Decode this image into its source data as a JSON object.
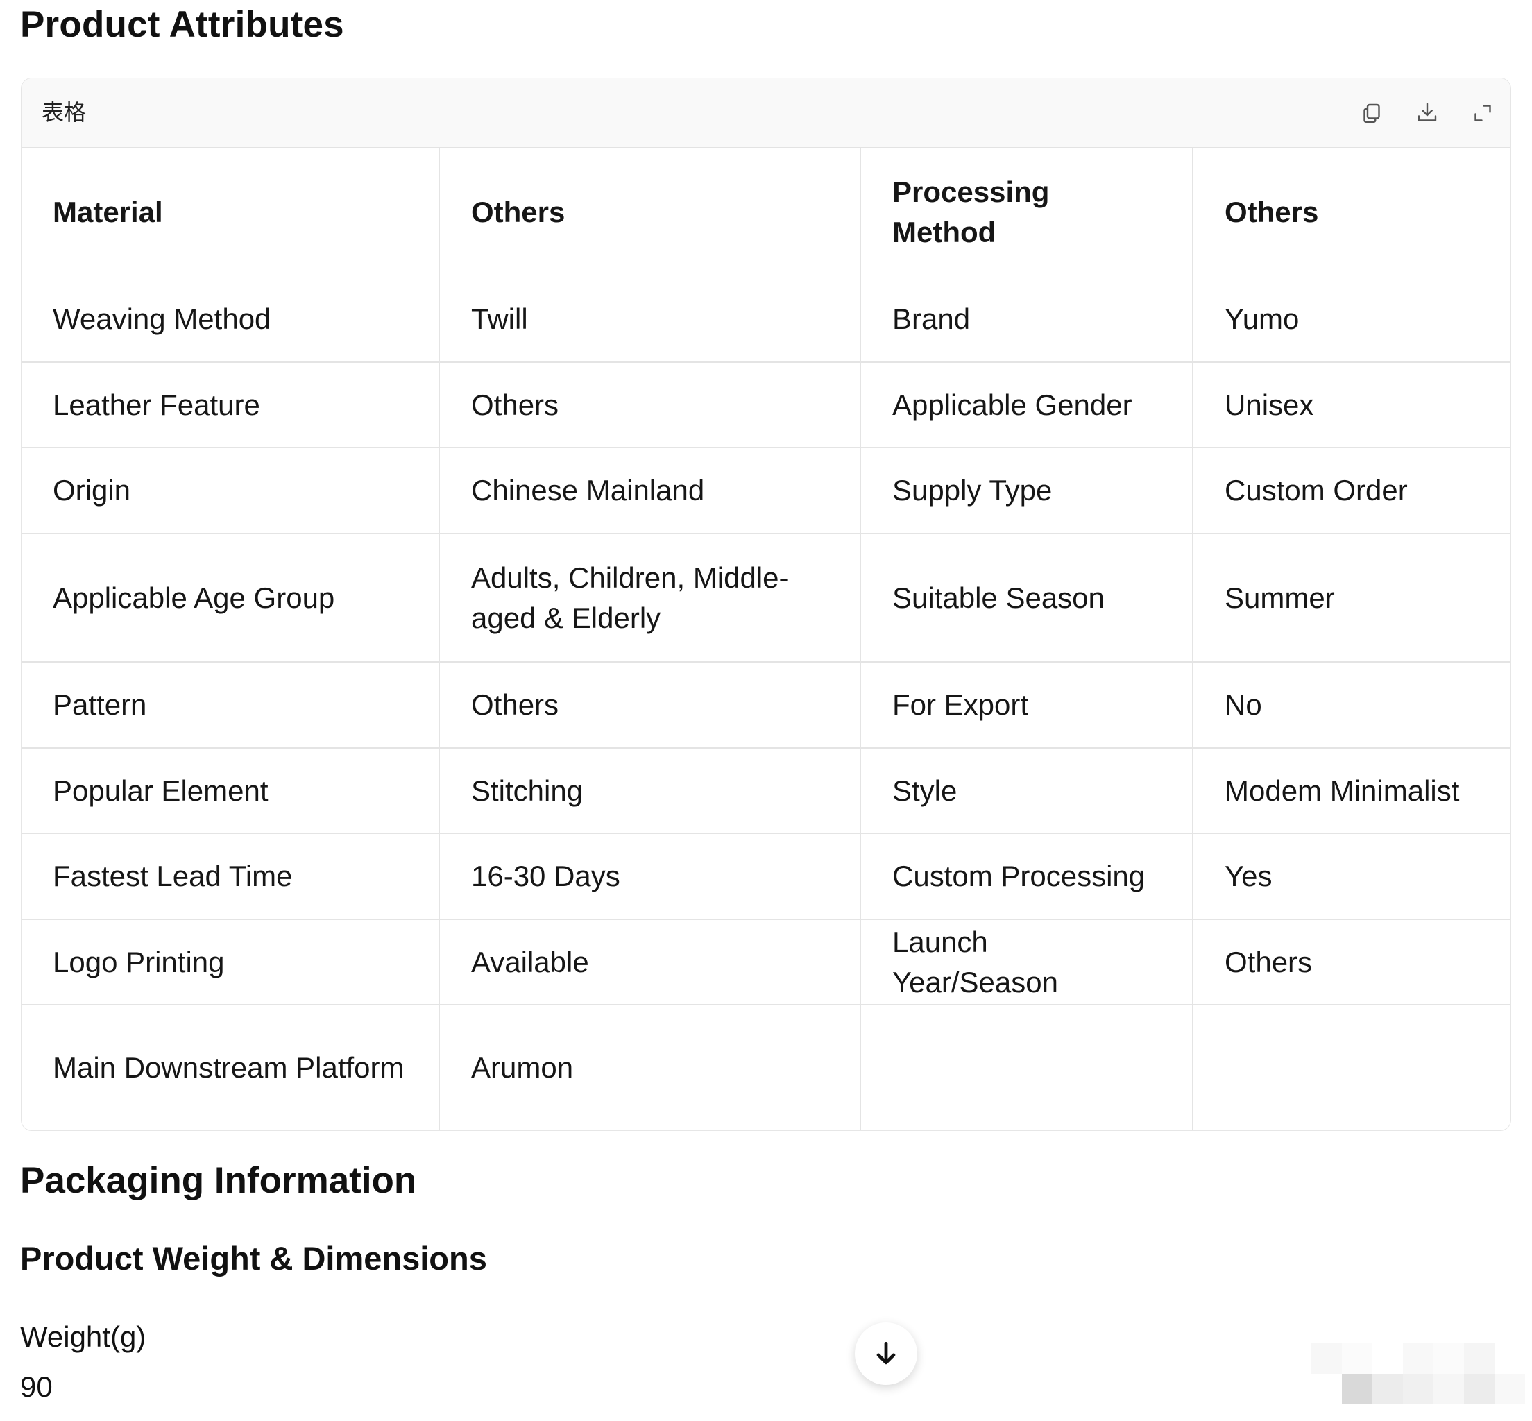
{
  "page": {
    "title": "Product Attributes",
    "packaging_heading": "Packaging Information",
    "weight_heading": "Product Weight & Dimensions",
    "weight_label": "Weight(g)",
    "weight_value": "90"
  },
  "table_card": {
    "title": "表格",
    "icons": [
      "copy-icon",
      "download-icon",
      "expand-icon"
    ]
  },
  "table": {
    "headers": [
      "Material",
      "Others",
      "Processing Method",
      "Others"
    ],
    "rows": [
      [
        "Weaving Method",
        "Twill",
        "Brand",
        "Yumo"
      ],
      [
        "Leather Feature",
        "Others",
        "Applicable Gender",
        "Unisex"
      ],
      [
        "Origin",
        "Chinese Mainland",
        "Supply Type",
        "Custom Order"
      ],
      [
        "Applicable Age Group",
        "Adults, Children, Middle-aged & Elderly",
        "Suitable Season",
        "Summer"
      ],
      [
        "Pattern",
        "Others",
        "For Export",
        "No"
      ],
      [
        "Popular Element",
        "Stitching",
        "Style",
        "Modem Minimalist"
      ],
      [
        "Fastest Lead Time",
        "16-30 Days",
        "Custom Processing",
        "Yes"
      ],
      [
        "Logo Printing",
        "Available",
        "Launch Year/Season",
        "Others"
      ],
      [
        "Main Downstream Platform",
        "Arumon",
        "",
        ""
      ]
    ]
  },
  "colors": {
    "text": "#111111",
    "border": "#e4e4e4",
    "toolbar_bg": "#f9f9f9",
    "icon": "#555555"
  }
}
